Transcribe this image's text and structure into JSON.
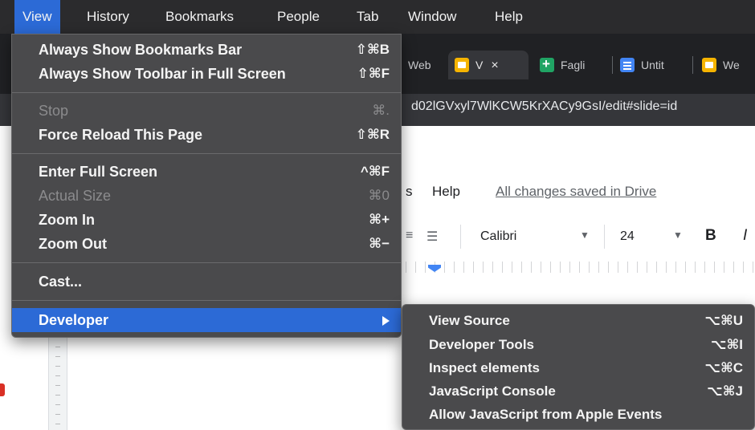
{
  "menubar": {
    "items": [
      "View",
      "History",
      "Bookmarks",
      "People",
      "Tab",
      "Window",
      "Help"
    ],
    "active": "View"
  },
  "tabs": [
    {
      "label": "Web",
      "icon": "none"
    },
    {
      "label": "V",
      "icon": "slides-icon",
      "active": true,
      "close": "×"
    },
    {
      "label": "Fagli",
      "icon": "sheets-icon"
    },
    {
      "label": "Untit",
      "icon": "docs-icon"
    },
    {
      "label": "We",
      "icon": "slides-icon"
    }
  ],
  "address_bar": {
    "url_fragment": "d02lGVxyl7WlKCW5KrXACy9GsI/edit#slide=id"
  },
  "document": {
    "menu_partial": "s",
    "menu_help": "Help",
    "save_status": "All changes saved in Drive",
    "font": "Calibri",
    "font_size": "24",
    "bold": "B",
    "italic": "I"
  },
  "view_menu": {
    "rows": [
      {
        "label": "Always Show Bookmarks Bar",
        "shortcut": "⇧⌘B",
        "enabled": true
      },
      {
        "label": "Always Show Toolbar in Full Screen",
        "shortcut": "⇧⌘F",
        "enabled": true
      },
      {
        "label": "Stop",
        "shortcut": "⌘.",
        "enabled": false
      },
      {
        "label": "Force Reload This Page",
        "shortcut": "⇧⌘R",
        "enabled": true
      },
      {
        "label": "Enter Full Screen",
        "shortcut": "^⌘F",
        "enabled": true
      },
      {
        "label": "Actual Size",
        "shortcut": "⌘0",
        "enabled": false
      },
      {
        "label": "Zoom In",
        "shortcut": "⌘+",
        "enabled": true
      },
      {
        "label": "Zoom Out",
        "shortcut": "⌘−",
        "enabled": true
      },
      {
        "label": "Cast...",
        "shortcut": "",
        "enabled": true
      },
      {
        "label": "Developer",
        "shortcut": "",
        "enabled": true,
        "highlighted": true,
        "submenu": true
      }
    ]
  },
  "developer_menu": {
    "rows": [
      {
        "label": "View Source",
        "shortcut": "⌥⌘U"
      },
      {
        "label": "Developer Tools",
        "shortcut": "⌥⌘I"
      },
      {
        "label": "Inspect elements",
        "shortcut": "⌥⌘C"
      },
      {
        "label": "JavaScript Console",
        "shortcut": "⌥⌘J"
      },
      {
        "label": "Allow JavaScript from Apple Events",
        "shortcut": ""
      }
    ]
  },
  "colors": {
    "menubar_bg": "#2b2b2d",
    "menu_bg": "#4a4a4c",
    "highlight": "#2c6ad6",
    "disabled_text": "#8b8b8d"
  }
}
